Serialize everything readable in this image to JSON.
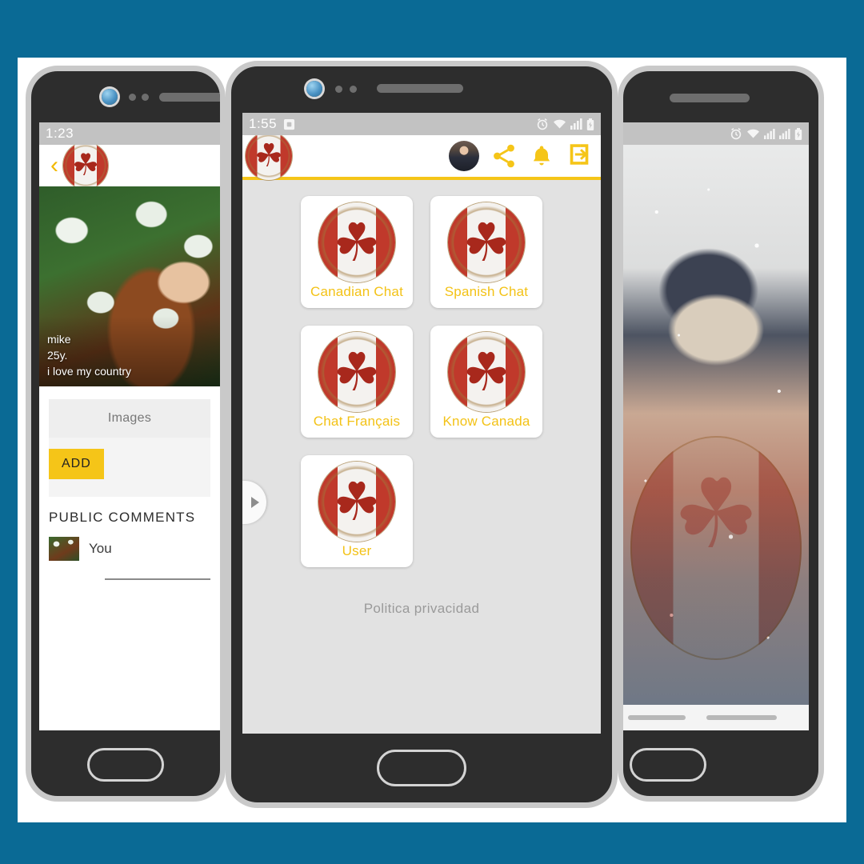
{
  "theme": {
    "background": "#0a6a95",
    "panel": "#ffffff",
    "accent_gold": "#f5c518",
    "tile_label": "#f3c216",
    "app_body": "#e2e2e2",
    "statusbar": "#c2c2c2"
  },
  "left_phone": {
    "statusbar": {
      "clock": "1:23"
    },
    "appbar": {
      "back_icon": "chevron-left-icon",
      "logo_icon": "canada-flag-logo",
      "leaf_glyph": "☘"
    },
    "hero": {
      "name": "mike",
      "age": "25y.",
      "bio": "i love my country"
    },
    "tabs": [
      {
        "label": "Images"
      }
    ],
    "add_button": {
      "label": "ADD"
    },
    "comments": {
      "title": "PUBLIC COMMENTS",
      "rows": [
        {
          "author": "You"
        }
      ]
    }
  },
  "center_phone": {
    "statusbar": {
      "clock": "1:55",
      "icons": [
        "screenshot-icon",
        "alarm-icon",
        "wifi-icon",
        "signal-icon",
        "battery-icon"
      ]
    },
    "appbar": {
      "logo_icon": "canada-flag-logo",
      "leaf_glyph": "☘",
      "actions": [
        {
          "name": "profile-avatar",
          "icon": "avatar-icon"
        },
        {
          "name": "share-button",
          "icon": "share-icon"
        },
        {
          "name": "notifications-button",
          "icon": "bell-icon"
        },
        {
          "name": "logout-button",
          "icon": "logout-icon"
        }
      ]
    },
    "drawer_handle": {
      "icon": "chevron-right-icon"
    },
    "grid": [
      {
        "label": "Canadian Chat",
        "icon": "canada-flag-logo"
      },
      {
        "label": "Spanish Chat",
        "icon": "canada-flag-logo"
      },
      {
        "label": "Chat Français",
        "icon": "canada-flag-logo"
      },
      {
        "label": "Know Canada",
        "icon": "canada-flag-logo"
      },
      {
        "label": "User",
        "icon": "canada-flag-logo"
      }
    ],
    "privacy_link": "Politica privacidad"
  },
  "right_phone": {
    "statusbar": {
      "clock": "",
      "icons": [
        "alarm-icon",
        "wifi-icon",
        "signal-icon",
        "signal2-icon",
        "battery-icon"
      ]
    },
    "photo": {
      "alt": "winter-portrait-photo",
      "watermark_icon": "canada-flag-watermark",
      "leaf_glyph": "☘"
    }
  }
}
